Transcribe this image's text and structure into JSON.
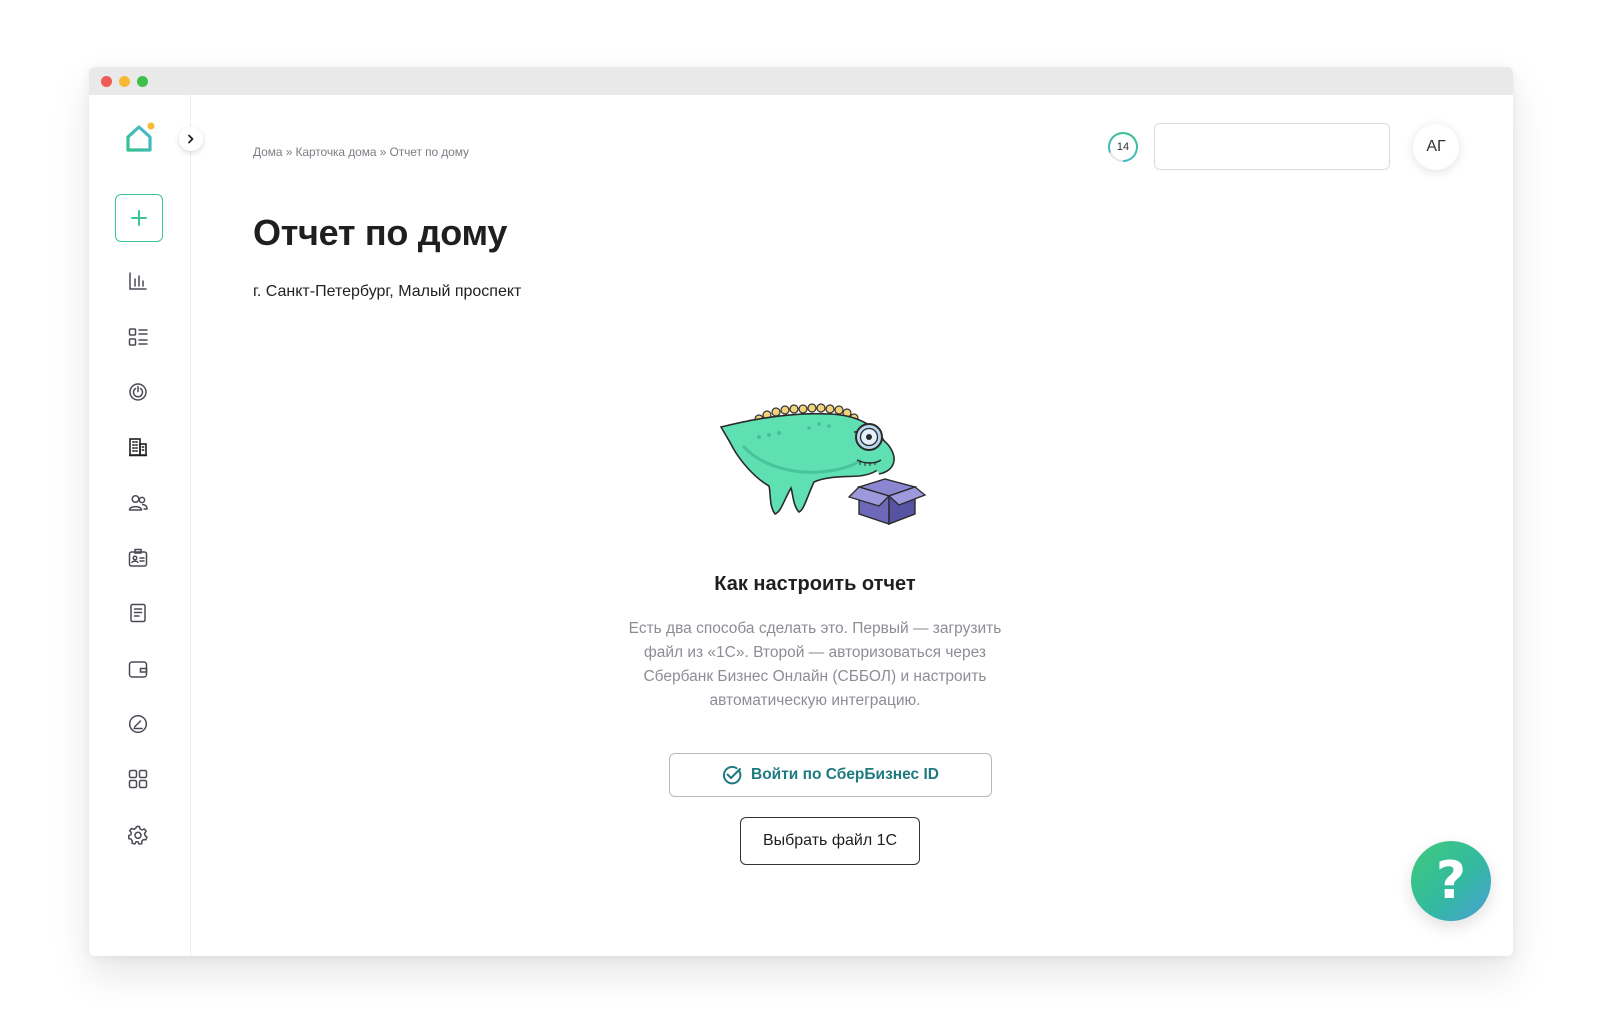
{
  "breadcrumb": {
    "items": [
      "Дома",
      "Карточка дома",
      "Отчет по дому"
    ],
    "separator": "»"
  },
  "header": {
    "counter": "14",
    "search_value": "",
    "avatar_initials": "АГ"
  },
  "page": {
    "title": "Отчет по дому",
    "address": "г. Санкт-Петербург, Малый проспект"
  },
  "empty_state": {
    "title": "Как настроить отчет",
    "text": "Есть два способа сделать это. Первый — загрузить файл из «1С». Второй — авторизоваться через Сбербанк Бизнес Онлайн (СББОЛ) и настроить автоматическую интеграцию.",
    "sber_button_label": "Войти по СберБизнес ID",
    "file_button_label": "Выбрать файл 1С"
  },
  "help": {
    "label": "?"
  },
  "sidebar": {
    "items": [
      {
        "icon": "analytics-icon"
      },
      {
        "icon": "list-icon"
      },
      {
        "icon": "power-icon"
      },
      {
        "icon": "building-icon"
      },
      {
        "icon": "people-icon"
      },
      {
        "icon": "id-card-icon"
      },
      {
        "icon": "document-icon"
      },
      {
        "icon": "wallet-icon"
      },
      {
        "icon": "speedometer-icon"
      },
      {
        "icon": "apps-icon"
      },
      {
        "icon": "settings-icon"
      }
    ]
  },
  "colors": {
    "accent": "#3cc49a",
    "link": "#1f7a80",
    "text_muted": "#8d8d95"
  }
}
